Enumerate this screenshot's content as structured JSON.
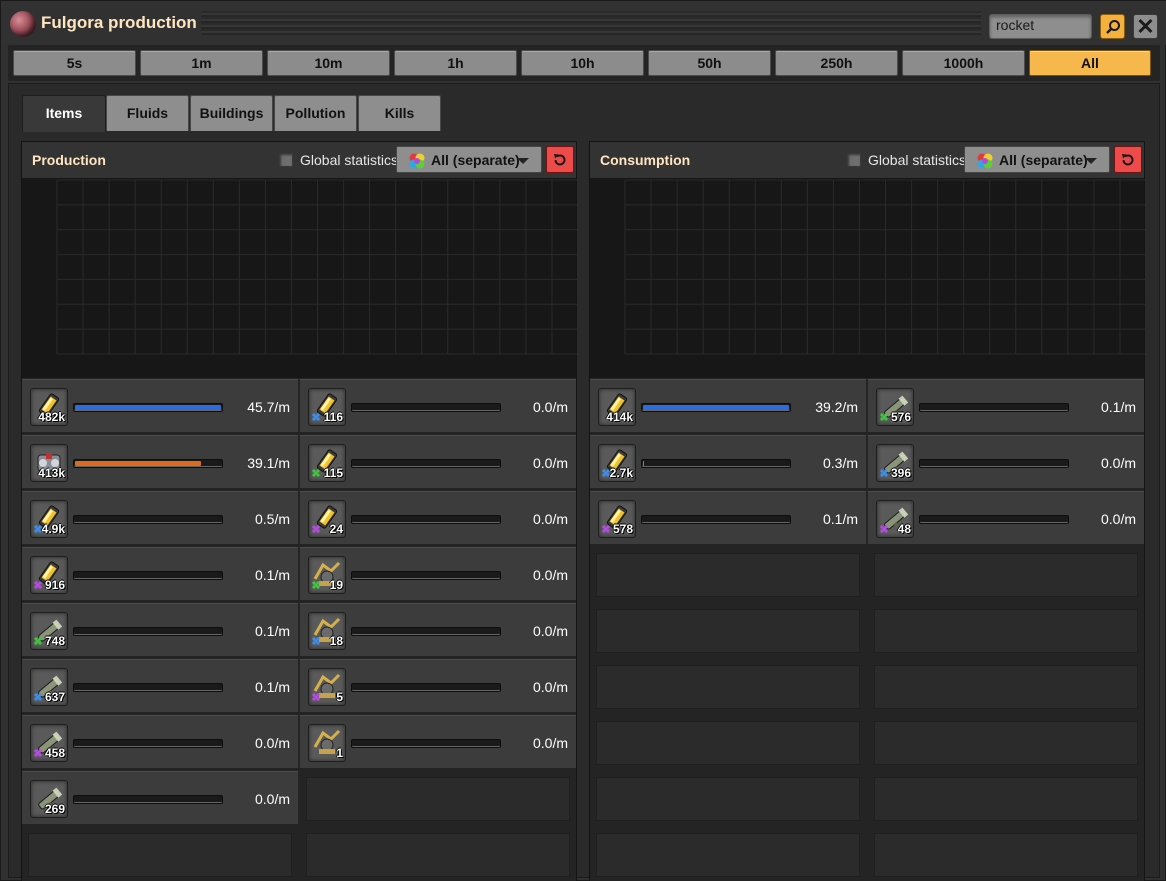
{
  "window": {
    "title": "Fulgora production"
  },
  "search": {
    "value": "rocket"
  },
  "time_ranges": [
    "5s",
    "1m",
    "10m",
    "1h",
    "10h",
    "50h",
    "250h",
    "1000h",
    "All"
  ],
  "active_time_range": "All",
  "tabs": [
    "Items",
    "Fluids",
    "Buildings",
    "Pollution",
    "Kills"
  ],
  "active_tab": "Items",
  "panels": {
    "production": {
      "title": "Production",
      "global_label": "Global statistics",
      "dropdown_label": "All (separate)",
      "items": [
        {
          "icon": "rocket-fuel-icon",
          "count": "482k",
          "rate": "45.7/m",
          "fill": 1.0,
          "color": "#2c6be0",
          "quality": ""
        },
        {
          "icon": "rocket-fuel-icon",
          "count": "116",
          "rate": "0.0/m",
          "fill": 0,
          "color": "#2c6be0",
          "quality": "rare"
        },
        {
          "icon": "rocket-part-icon",
          "count": "413k",
          "rate": "39.1/m",
          "fill": 0.86,
          "color": "#e06a1c",
          "quality": ""
        },
        {
          "icon": "rocket-fuel-icon",
          "count": "115",
          "rate": "0.0/m",
          "fill": 0,
          "color": "#2c6be0",
          "quality": "uncommon"
        },
        {
          "icon": "rocket-fuel-icon",
          "count": "4.9k",
          "rate": "0.5/m",
          "fill": 0,
          "color": "#2c6be0",
          "quality": "rare"
        },
        {
          "icon": "rocket-fuel-icon",
          "count": "24",
          "rate": "0.0/m",
          "fill": 0,
          "color": "#2c6be0",
          "quality": "epic"
        },
        {
          "icon": "rocket-fuel-icon",
          "count": "916",
          "rate": "0.1/m",
          "fill": 0,
          "color": "#2c6be0",
          "quality": "epic"
        },
        {
          "icon": "rocket-silo-icon",
          "count": "19",
          "rate": "0.0/m",
          "fill": 0,
          "color": "#2c6be0",
          "quality": "uncommon"
        },
        {
          "icon": "rocket-launcher-icon",
          "count": "748",
          "rate": "0.1/m",
          "fill": 0,
          "color": "#2c6be0",
          "quality": "uncommon"
        },
        {
          "icon": "rocket-silo-icon",
          "count": "18",
          "rate": "0.0/m",
          "fill": 0,
          "color": "#2c6be0",
          "quality": "rare"
        },
        {
          "icon": "rocket-launcher-icon",
          "count": "637",
          "rate": "0.1/m",
          "fill": 0,
          "color": "#2c6be0",
          "quality": "rare"
        },
        {
          "icon": "rocket-silo-icon",
          "count": "5",
          "rate": "0.0/m",
          "fill": 0,
          "color": "#2c6be0",
          "quality": "epic"
        },
        {
          "icon": "rocket-launcher-icon",
          "count": "458",
          "rate": "0.0/m",
          "fill": 0,
          "color": "#2c6be0",
          "quality": "epic"
        },
        {
          "icon": "rocket-silo-icon",
          "count": "1",
          "rate": "0.0/m",
          "fill": 0,
          "color": "#2c6be0",
          "quality": ""
        },
        {
          "icon": "rocket-launcher-icon",
          "count": "269",
          "rate": "0.0/m",
          "fill": 0,
          "color": "#2c6be0",
          "quality": ""
        }
      ]
    },
    "consumption": {
      "title": "Consumption",
      "global_label": "Global statistics",
      "dropdown_label": "All (separate)",
      "items": [
        {
          "icon": "rocket-fuel-icon",
          "count": "414k",
          "rate": "39.2/m",
          "fill": 1.0,
          "color": "#2c6be0",
          "quality": ""
        },
        {
          "icon": "rocket-launcher-icon",
          "count": "576",
          "rate": "0.1/m",
          "fill": 0,
          "color": "#2c6be0",
          "quality": "uncommon"
        },
        {
          "icon": "rocket-fuel-icon",
          "count": "2.7k",
          "rate": "0.3/m",
          "fill": 0.01,
          "color": "#e06a1c",
          "quality": "rare"
        },
        {
          "icon": "rocket-launcher-icon",
          "count": "396",
          "rate": "0.0/m",
          "fill": 0,
          "color": "#2c6be0",
          "quality": "rare"
        },
        {
          "icon": "rocket-fuel-icon",
          "count": "578",
          "rate": "0.1/m",
          "fill": 0,
          "color": "#2c6be0",
          "quality": "epic"
        },
        {
          "icon": "rocket-launcher-icon",
          "count": "48",
          "rate": "0.0/m",
          "fill": 0,
          "color": "#2c6be0",
          "quality": "epic"
        }
      ]
    }
  }
}
